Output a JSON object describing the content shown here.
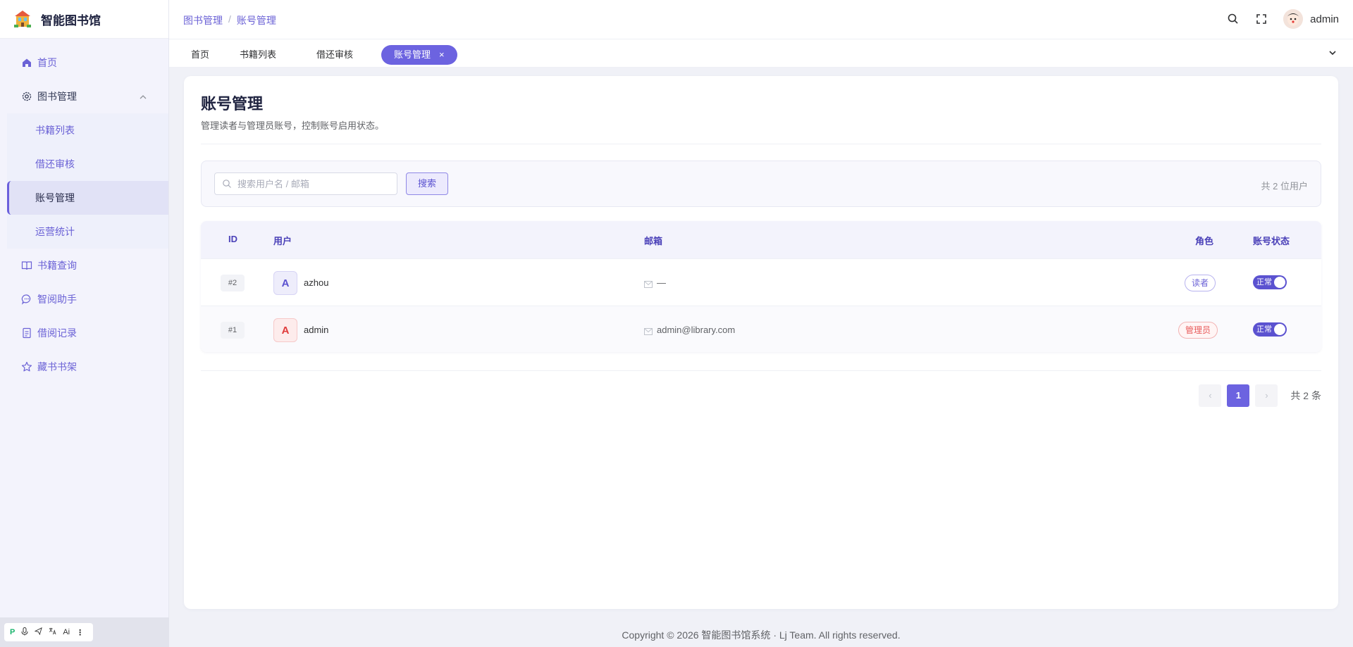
{
  "app": {
    "name": "智能图书馆"
  },
  "sidebar": {
    "items": [
      {
        "label": "首页",
        "icon": "home-icon"
      },
      {
        "label": "图书管理",
        "icon": "gear-icon",
        "expanded": true,
        "children": [
          "书籍列表",
          "借还审核",
          "账号管理",
          "运营统计"
        ],
        "active_child": "账号管理"
      },
      {
        "label": "书籍查询",
        "icon": "book-icon"
      },
      {
        "label": "智阅助手",
        "icon": "chat-icon"
      },
      {
        "label": "借阅记录",
        "icon": "document-icon"
      },
      {
        "label": "藏书书架",
        "icon": "star-icon"
      }
    ]
  },
  "mini_toolbar": {
    "items": [
      "pinyin-icon",
      "mic-icon",
      "send-icon",
      "translate-icon",
      "ai-icon",
      "more-icon"
    ],
    "ai_label": "Ai"
  },
  "header": {
    "breadcrumb": [
      "图书管理",
      "账号管理"
    ],
    "username": "admin"
  },
  "tabs": [
    {
      "label": "首页",
      "active": false
    },
    {
      "label": "书籍列表",
      "active": false
    },
    {
      "label": "借还审核",
      "active": false
    },
    {
      "label": "账号管理",
      "active": true,
      "close": "×"
    }
  ],
  "page": {
    "title": "账号管理",
    "description": "管理读者与管理员账号，控制账号启用状态。",
    "search_placeholder": "搜索用户名 / 邮箱",
    "search_button": "搜索",
    "user_count": "共 2 位用户"
  },
  "table": {
    "columns": [
      "ID",
      "用户",
      "邮箱",
      "角色",
      "账号状态"
    ],
    "rows": [
      {
        "id": "#2",
        "avatar": "A",
        "name": "azhou",
        "email": "—",
        "role": "读者",
        "role_type": "reader",
        "status": "正常"
      },
      {
        "id": "#1",
        "avatar": "A",
        "name": "admin",
        "email": "admin@library.com",
        "role": "管理员",
        "role_type": "admin",
        "status": "正常"
      }
    ]
  },
  "pagination": {
    "prev": "‹",
    "current": "1",
    "next": "›",
    "total": "共 2 条"
  },
  "footer": {
    "text": "Copyright © 2026 智能图书馆系统 · Lj Team. All rights reserved."
  },
  "colors": {
    "accent": "#6c63e0",
    "danger": "#e85c5c"
  }
}
